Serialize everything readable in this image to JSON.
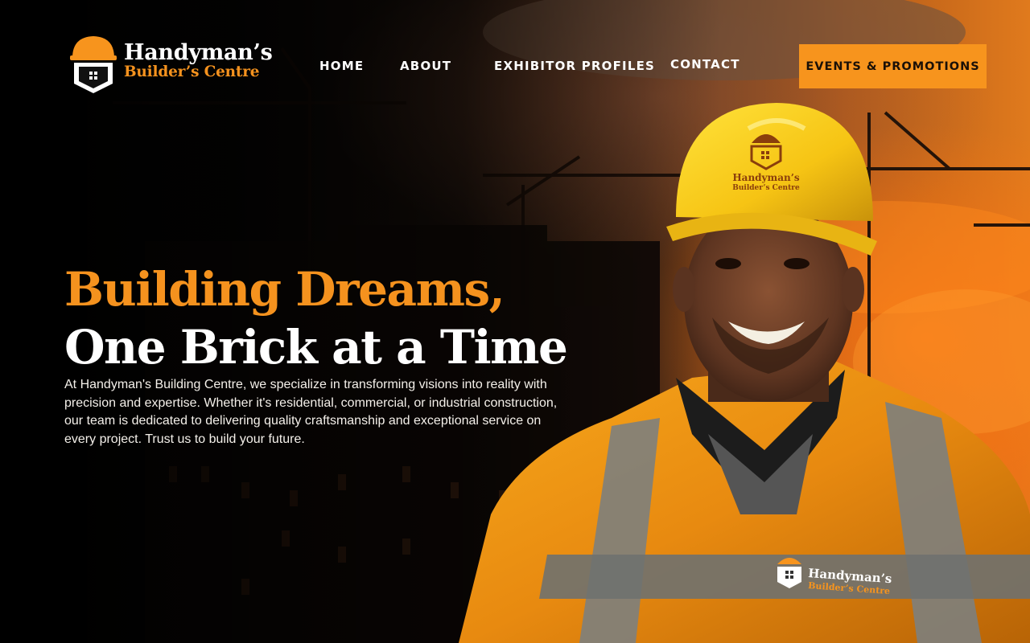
{
  "brand": {
    "name_line1": "Handyman’s",
    "name_line2": "Builder’s Centre",
    "hat_logo_line1": "Handyman’s",
    "hat_logo_line2": "Builder’s Centre",
    "accent_color": "#f5921e"
  },
  "nav": {
    "items": [
      {
        "label": "HOME"
      },
      {
        "label": "ABOUT"
      },
      {
        "label": "EXHIBITOR PROFILES"
      },
      {
        "label": "CONTACT"
      }
    ],
    "cta_label": "EVENTS & PROMOTIONS"
  },
  "hero": {
    "headline_line1": "Building Dreams,",
    "headline_line2": "One Brick at a Time",
    "description": "At Handyman's Building Centre, we specialize in transforming visions into reality with precision and expertise. Whether it's residential, commercial, or industrial construction, our team is dedicated to delivering quality craftsmanship and exceptional service on every project. Trust us to build your future."
  },
  "icons": [
    "hard-hat-logo-icon",
    "house-shield-icon"
  ]
}
